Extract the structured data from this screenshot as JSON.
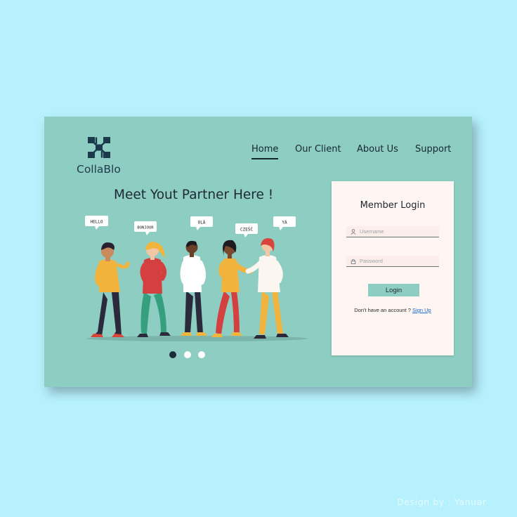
{
  "brand": {
    "name": "CollaBlo",
    "logo_icon": "network-nodes-icon"
  },
  "nav": {
    "items": [
      {
        "label": "Home",
        "active": true
      },
      {
        "label": "Our Client",
        "active": false
      },
      {
        "label": "About Us",
        "active": false
      },
      {
        "label": "Support",
        "active": false
      }
    ]
  },
  "hero": {
    "headline": "Meet Yout Partner Here !",
    "bubbles": [
      "HELLO",
      "BONJOUR",
      "OLÁ",
      "CZEŚĆ",
      "YÁ"
    ],
    "carousel": {
      "count": 3,
      "active_index": 0
    }
  },
  "login": {
    "title": "Member Login",
    "username": {
      "placeholder": "Username",
      "value": "",
      "icon": "user-icon"
    },
    "password": {
      "placeholder": "Password",
      "value": "",
      "icon": "lock-icon"
    },
    "submit_label": "Login",
    "signup_prompt": "Don't have an account ?",
    "signup_link": "Sign Up"
  },
  "credit": "Design by : Yanuar",
  "colors": {
    "background": "#b6f1fd",
    "card": "#8ecec2",
    "panel": "#fff6f3",
    "primary_dark": "#16262f",
    "link": "#1769c7"
  }
}
